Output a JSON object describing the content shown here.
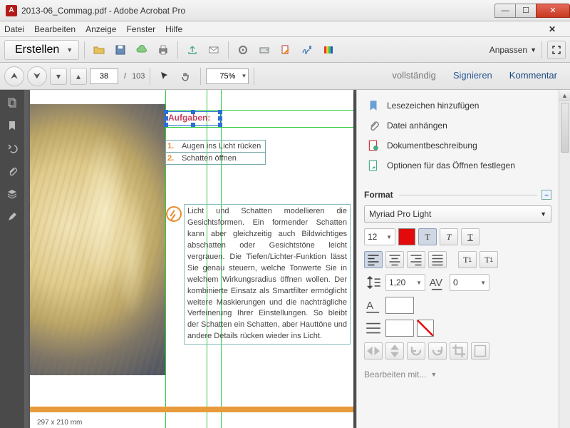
{
  "window": {
    "title": "2013-06_Commag.pdf - Adobe Acrobat Pro"
  },
  "menu": {
    "items": [
      "Datei",
      "Bearbeiten",
      "Anzeige",
      "Fenster",
      "Hilfe"
    ]
  },
  "toolbar1": {
    "create_label": "Erstellen",
    "customize_label": "Anpassen"
  },
  "toolbar2": {
    "page_current": "38",
    "page_total": "103",
    "zoom": "75%",
    "links": {
      "full": "vollständig",
      "sign": "Signieren",
      "comment": "Kommentar"
    }
  },
  "doc": {
    "dimensions": "297 x 210 mm",
    "selected_text": "Aufgaben:",
    "tasks": [
      {
        "n": "1.",
        "t": "Augen ins Licht rücken"
      },
      {
        "n": "2.",
        "t": "Schatten öffnen"
      }
    ],
    "body": "Licht und Schatten modellieren die Gesichtsformen. Ein formender Schatten kann aber gleichzeitig auch Bildwichtiges abschatten oder Gesichtstöne leicht vergrauen. Die Tiefen/Lichter-Funktion lässt Sie genau steuern, welche Tonwerte Sie in welchem Wirkungsradius öffnen wollen. Der kombinierte Einsatz als Smartfilter ermöglicht weitere Maskierungen und die nachträgliche Verfeinerung Ihrer Einstellungen. So bleibt der Schatten ein Schatten, aber Hauttöne und andere Details rücken wieder ins Licht."
  },
  "panel": {
    "actions": {
      "bookmark": "Lesezeichen hinzufügen",
      "attach": "Datei anhängen",
      "desc": "Dokumentbeschreibung",
      "openopts": "Optionen für das Öffnen festlegen"
    },
    "format": {
      "header": "Format",
      "font": "Myriad Pro Light",
      "size": "12",
      "leading": "1,20",
      "tracking": "0",
      "edit_with": "Bearbeiten mit..."
    }
  }
}
